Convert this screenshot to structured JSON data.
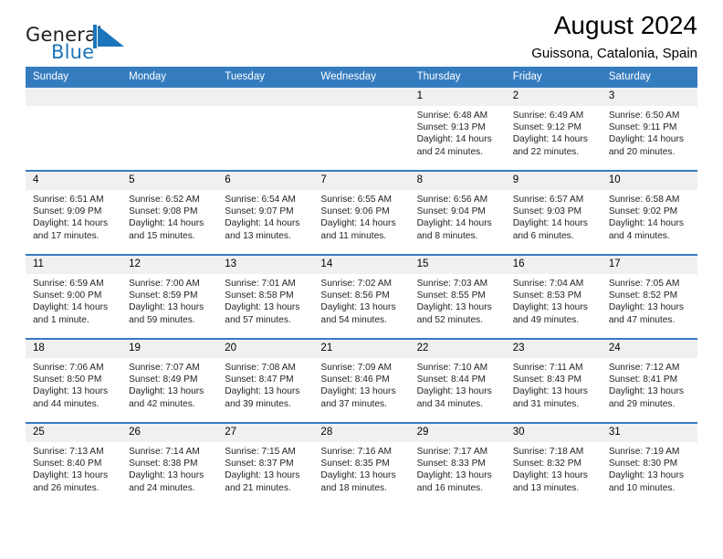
{
  "brand": {
    "name_part1": "General",
    "name_part2": "Blue",
    "mark": "triangle-flag-logo"
  },
  "header": {
    "title": "August 2024",
    "subtitle": "Guissona, Catalonia, Spain"
  },
  "calendar": {
    "weekday_headers": [
      "Sunday",
      "Monday",
      "Tuesday",
      "Wednesday",
      "Thursday",
      "Friday",
      "Saturday"
    ],
    "accent_color": "#357cbf",
    "daynum_bg": "#f0f0f0",
    "weeks": [
      [
        {
          "day": "",
          "empty": true
        },
        {
          "day": "",
          "empty": true
        },
        {
          "day": "",
          "empty": true
        },
        {
          "day": "",
          "empty": true
        },
        {
          "day": "1",
          "sunrise": "Sunrise: 6:48 AM",
          "sunset": "Sunset: 9:13 PM",
          "daylight": "Daylight: 14 hours and 24 minutes."
        },
        {
          "day": "2",
          "sunrise": "Sunrise: 6:49 AM",
          "sunset": "Sunset: 9:12 PM",
          "daylight": "Daylight: 14 hours and 22 minutes."
        },
        {
          "day": "3",
          "sunrise": "Sunrise: 6:50 AM",
          "sunset": "Sunset: 9:11 PM",
          "daylight": "Daylight: 14 hours and 20 minutes."
        }
      ],
      [
        {
          "day": "4",
          "sunrise": "Sunrise: 6:51 AM",
          "sunset": "Sunset: 9:09 PM",
          "daylight": "Daylight: 14 hours and 17 minutes."
        },
        {
          "day": "5",
          "sunrise": "Sunrise: 6:52 AM",
          "sunset": "Sunset: 9:08 PM",
          "daylight": "Daylight: 14 hours and 15 minutes."
        },
        {
          "day": "6",
          "sunrise": "Sunrise: 6:54 AM",
          "sunset": "Sunset: 9:07 PM",
          "daylight": "Daylight: 14 hours and 13 minutes."
        },
        {
          "day": "7",
          "sunrise": "Sunrise: 6:55 AM",
          "sunset": "Sunset: 9:06 PM",
          "daylight": "Daylight: 14 hours and 11 minutes."
        },
        {
          "day": "8",
          "sunrise": "Sunrise: 6:56 AM",
          "sunset": "Sunset: 9:04 PM",
          "daylight": "Daylight: 14 hours and 8 minutes."
        },
        {
          "day": "9",
          "sunrise": "Sunrise: 6:57 AM",
          "sunset": "Sunset: 9:03 PM",
          "daylight": "Daylight: 14 hours and 6 minutes."
        },
        {
          "day": "10",
          "sunrise": "Sunrise: 6:58 AM",
          "sunset": "Sunset: 9:02 PM",
          "daylight": "Daylight: 14 hours and 4 minutes."
        }
      ],
      [
        {
          "day": "11",
          "sunrise": "Sunrise: 6:59 AM",
          "sunset": "Sunset: 9:00 PM",
          "daylight": "Daylight: 14 hours and 1 minute."
        },
        {
          "day": "12",
          "sunrise": "Sunrise: 7:00 AM",
          "sunset": "Sunset: 8:59 PM",
          "daylight": "Daylight: 13 hours and 59 minutes."
        },
        {
          "day": "13",
          "sunrise": "Sunrise: 7:01 AM",
          "sunset": "Sunset: 8:58 PM",
          "daylight": "Daylight: 13 hours and 57 minutes."
        },
        {
          "day": "14",
          "sunrise": "Sunrise: 7:02 AM",
          "sunset": "Sunset: 8:56 PM",
          "daylight": "Daylight: 13 hours and 54 minutes."
        },
        {
          "day": "15",
          "sunrise": "Sunrise: 7:03 AM",
          "sunset": "Sunset: 8:55 PM",
          "daylight": "Daylight: 13 hours and 52 minutes."
        },
        {
          "day": "16",
          "sunrise": "Sunrise: 7:04 AM",
          "sunset": "Sunset: 8:53 PM",
          "daylight": "Daylight: 13 hours and 49 minutes."
        },
        {
          "day": "17",
          "sunrise": "Sunrise: 7:05 AM",
          "sunset": "Sunset: 8:52 PM",
          "daylight": "Daylight: 13 hours and 47 minutes."
        }
      ],
      [
        {
          "day": "18",
          "sunrise": "Sunrise: 7:06 AM",
          "sunset": "Sunset: 8:50 PM",
          "daylight": "Daylight: 13 hours and 44 minutes."
        },
        {
          "day": "19",
          "sunrise": "Sunrise: 7:07 AM",
          "sunset": "Sunset: 8:49 PM",
          "daylight": "Daylight: 13 hours and 42 minutes."
        },
        {
          "day": "20",
          "sunrise": "Sunrise: 7:08 AM",
          "sunset": "Sunset: 8:47 PM",
          "daylight": "Daylight: 13 hours and 39 minutes."
        },
        {
          "day": "21",
          "sunrise": "Sunrise: 7:09 AM",
          "sunset": "Sunset: 8:46 PM",
          "daylight": "Daylight: 13 hours and 37 minutes."
        },
        {
          "day": "22",
          "sunrise": "Sunrise: 7:10 AM",
          "sunset": "Sunset: 8:44 PM",
          "daylight": "Daylight: 13 hours and 34 minutes."
        },
        {
          "day": "23",
          "sunrise": "Sunrise: 7:11 AM",
          "sunset": "Sunset: 8:43 PM",
          "daylight": "Daylight: 13 hours and 31 minutes."
        },
        {
          "day": "24",
          "sunrise": "Sunrise: 7:12 AM",
          "sunset": "Sunset: 8:41 PM",
          "daylight": "Daylight: 13 hours and 29 minutes."
        }
      ],
      [
        {
          "day": "25",
          "sunrise": "Sunrise: 7:13 AM",
          "sunset": "Sunset: 8:40 PM",
          "daylight": "Daylight: 13 hours and 26 minutes."
        },
        {
          "day": "26",
          "sunrise": "Sunrise: 7:14 AM",
          "sunset": "Sunset: 8:38 PM",
          "daylight": "Daylight: 13 hours and 24 minutes."
        },
        {
          "day": "27",
          "sunrise": "Sunrise: 7:15 AM",
          "sunset": "Sunset: 8:37 PM",
          "daylight": "Daylight: 13 hours and 21 minutes."
        },
        {
          "day": "28",
          "sunrise": "Sunrise: 7:16 AM",
          "sunset": "Sunset: 8:35 PM",
          "daylight": "Daylight: 13 hours and 18 minutes."
        },
        {
          "day": "29",
          "sunrise": "Sunrise: 7:17 AM",
          "sunset": "Sunset: 8:33 PM",
          "daylight": "Daylight: 13 hours and 16 minutes."
        },
        {
          "day": "30",
          "sunrise": "Sunrise: 7:18 AM",
          "sunset": "Sunset: 8:32 PM",
          "daylight": "Daylight: 13 hours and 13 minutes."
        },
        {
          "day": "31",
          "sunrise": "Sunrise: 7:19 AM",
          "sunset": "Sunset: 8:30 PM",
          "daylight": "Daylight: 13 hours and 10 minutes."
        }
      ]
    ]
  }
}
